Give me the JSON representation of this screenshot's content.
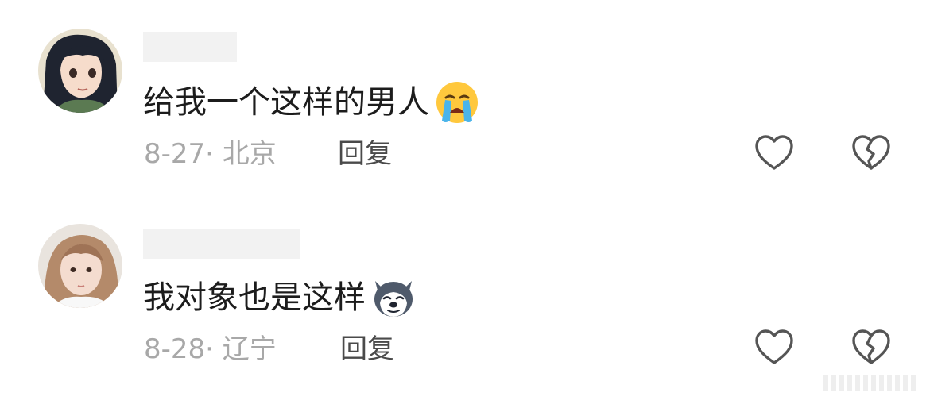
{
  "comments": [
    {
      "text": "给我一个这样的男人",
      "emoji": "loudly-crying-face-icon",
      "date": "8-27",
      "separator": "·",
      "location": "北京",
      "reply_label": "回复",
      "like_icon": "heart-outline-icon",
      "dislike_icon": "broken-heart-outline-icon"
    },
    {
      "text": "我对象也是这样",
      "emoji": "husky-dog-face-icon",
      "date": "8-28",
      "separator": "·",
      "location": "辽宁",
      "reply_label": "回复",
      "like_icon": "heart-outline-icon",
      "dislike_icon": "broken-heart-outline-icon"
    }
  ],
  "colors": {
    "text": "#1c1c1c",
    "meta": "#a8a8a8",
    "reply": "#4a4a4a",
    "icon_stroke": "#555555",
    "redaction": "#f2f2f2"
  }
}
